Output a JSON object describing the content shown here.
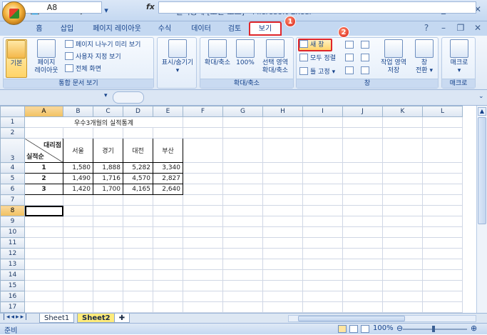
{
  "window": {
    "title": "실적통계  [호환 모드] - Microsoft Excel"
  },
  "qat": [
    {
      "icon": "save-icon",
      "glyph": "💾"
    },
    {
      "icon": "undo-icon",
      "glyph": "↶"
    },
    {
      "icon": "redo-icon",
      "glyph": "↷"
    },
    {
      "icon": "print-preview-icon",
      "glyph": "🔍"
    },
    {
      "icon": "quick-print-icon",
      "glyph": "⎙"
    }
  ],
  "tabs": [
    "홈",
    "삽입",
    "페이지 레이아웃",
    "수식",
    "데이터",
    "검토",
    "보기"
  ],
  "active_tab": "보기",
  "badges": [
    "1",
    "2"
  ],
  "ribbon": {
    "workbook_views": {
      "label": "통합 문서 보기",
      "normal": "기본",
      "page_layout_1": "페이지",
      "page_layout_2": "레이아웃",
      "page_break": "페이지 나누기 미리 보기",
      "custom_views": "사용자 지정 보기",
      "full_screen": "전체 화면"
    },
    "show_hide": {
      "label": "표시/숨기기"
    },
    "zoom": {
      "label": "확대/축소",
      "zoom": "확대/축소",
      "pct100": "100%",
      "zoom_sel_1": "선택 영역",
      "zoom_sel_2": "확대/축소"
    },
    "window": {
      "label": "창",
      "new_window": "새 창",
      "arrange_all": "모두 정렬",
      "freeze": "틀 고정",
      "save_ws_1": "작업 영역",
      "save_ws_2": "저장",
      "switch_1": "창",
      "switch_2": "전환"
    },
    "macros": {
      "label": "매크로",
      "macros": "매크로"
    }
  },
  "formula_bar": {
    "name_box": "A8",
    "fx": "fx",
    "value": ""
  },
  "columns": [
    "A",
    "B",
    "C",
    "D",
    "E",
    "F",
    "G",
    "H",
    "I",
    "J",
    "K",
    "L"
  ],
  "rows": [
    "1",
    "2",
    "3",
    "4",
    "5",
    "6",
    "7",
    "8",
    "9",
    "10",
    "11",
    "12",
    "13",
    "14",
    "15",
    "16",
    "17",
    "18"
  ],
  "sheet": {
    "title": "우수3개월의 실적통계",
    "corner_top": "대리점",
    "corner_bottom": "실적순",
    "headers": [
      "서울",
      "경기",
      "대전",
      "부산"
    ],
    "data": [
      {
        "rank": "1",
        "values": [
          "1,580",
          "1,888",
          "5,282",
          "3,340"
        ]
      },
      {
        "rank": "2",
        "values": [
          "1,490",
          "1,716",
          "4,570",
          "2,827"
        ]
      },
      {
        "rank": "3",
        "values": [
          "1,420",
          "1,700",
          "4,165",
          "2,640"
        ]
      }
    ]
  },
  "sheet_tabs": [
    "Sheet1",
    "Sheet2"
  ],
  "status": {
    "ready": "준비",
    "zoom": "100%"
  },
  "colors": {
    "accent": "#15428b",
    "highlight": "#e0262b",
    "badge": "#d8231a"
  }
}
